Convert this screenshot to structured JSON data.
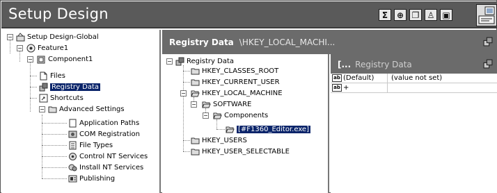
{
  "app": {
    "title": "Setup Design"
  },
  "toolbar": {
    "icons": [
      "sigma-icon",
      "globe-icon",
      "dialog-icon",
      "person-icon",
      "window-icon"
    ],
    "glyphs": [
      "Σ",
      "⊕",
      "❐",
      "♙",
      "▣"
    ]
  },
  "left_tree": {
    "items": [
      {
        "label": "Setup Design-Global",
        "icon": "setup-icon"
      },
      {
        "label": "Feature1",
        "icon": "feature-icon"
      },
      {
        "label": "Component1",
        "icon": "component-icon"
      },
      {
        "label": "Files",
        "icon": "files-icon"
      },
      {
        "label": "Registry Data",
        "icon": "registry-icon",
        "selected": true
      },
      {
        "label": "Shortcuts",
        "icon": "shortcut-icon"
      },
      {
        "label": "Advanced Settings",
        "icon": "folder-icon"
      },
      {
        "label": "Application Paths",
        "icon": "document-icon"
      },
      {
        "label": "COM Registration",
        "icon": "com-icon"
      },
      {
        "label": "File Types",
        "icon": "filetype-icon"
      },
      {
        "label": "Control NT Services",
        "icon": "service-control-icon"
      },
      {
        "label": "Install NT Services",
        "icon": "service-install-icon"
      },
      {
        "label": "Publishing",
        "icon": "publishing-icon"
      }
    ]
  },
  "right_header": {
    "title": "Registry Data",
    "path": "\\HKEY_LOCAL_MACHI..."
  },
  "registry_tree": {
    "items": [
      {
        "label": "Registry Data",
        "icon": "registry-icon"
      },
      {
        "label": "HKEY_CLASSES_ROOT",
        "icon": "folder-icon"
      },
      {
        "label": "HKEY_CURRENT_USER",
        "icon": "folder-icon"
      },
      {
        "label": "HKEY_LOCAL_MACHINE",
        "icon": "folder-open-icon"
      },
      {
        "label": "SOFTWARE",
        "icon": "folder-open-icon"
      },
      {
        "label": "Components",
        "icon": "folder-open-icon"
      },
      {
        "label": "[#F1360_Editor.exe]",
        "icon": "folder-open-icon",
        "selected": true
      },
      {
        "label": "HKEY_USERS",
        "icon": "folder-icon"
      },
      {
        "label": "HKEY_USER_SELECTABLE",
        "icon": "folder-icon"
      }
    ]
  },
  "list_panel": {
    "header_prefix": "[...",
    "header_title": "Registry Data",
    "rows": [
      {
        "name": "(Default)",
        "value": "(value not set)"
      },
      {
        "name": "+",
        "value": ""
      }
    ]
  },
  "colors": {
    "titlebar": "#5a5a5a",
    "header": "#6b6b6b",
    "selection": "#0a246a"
  }
}
